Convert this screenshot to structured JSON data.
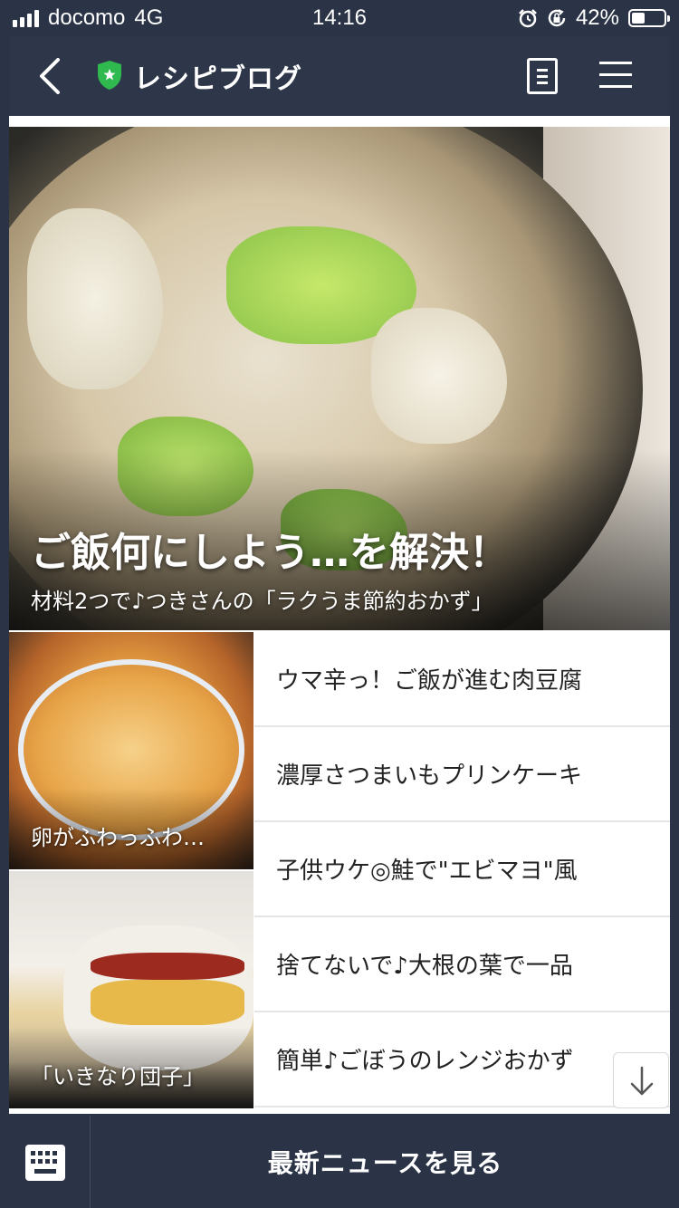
{
  "status_bar": {
    "carrier": "docomo",
    "network": "4G",
    "time": "14:16",
    "battery_percent": "42%",
    "battery_level": 0.42,
    "icons": [
      "alarm-icon",
      "rotation-lock-icon"
    ]
  },
  "nav": {
    "title": "レシピブログ",
    "back_icon": "chevron-left-icon",
    "shield_icon": "shield-icon",
    "doc_icon": "document-icon",
    "menu_icon": "hamburger-menu-icon"
  },
  "hero": {
    "title": "ご飯何にしよう…を解決！",
    "subtitle": "材料2つで♪つきさんの「ラクうま節約おかず」"
  },
  "thumbs": [
    {
      "caption": "卵がふわっふわ…"
    },
    {
      "caption": "「いきなり団子」"
    }
  ],
  "articles": [
    "ウマ辛っ！ご飯が進む肉豆腐",
    "濃厚さつまいもプリンケーキ",
    "子供ウケ◎鮭で\"エビマヨ\"風",
    "捨てないで♪大根の葉で一品",
    "簡単♪ごぼうのレンジおかず"
  ],
  "footer": {
    "keyboard_icon": "keyboard-icon",
    "button_label": "最新ニュースを見る"
  },
  "colors": {
    "nav_bg": "#2e3749",
    "shield_green": "#2fb94f"
  }
}
